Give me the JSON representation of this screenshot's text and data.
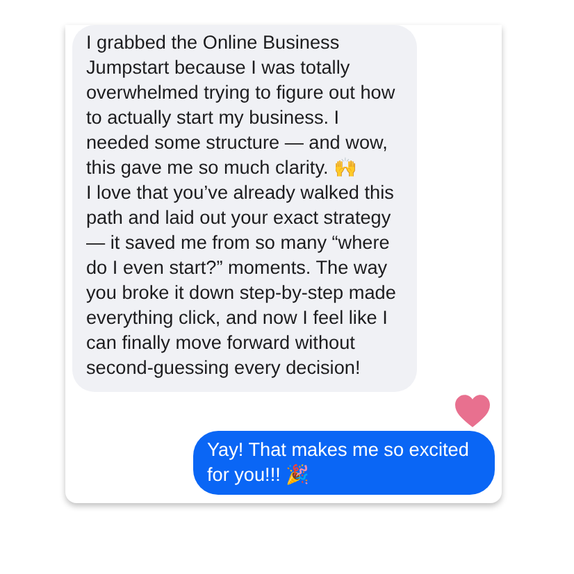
{
  "messages": [
    {
      "kind": "received",
      "paragraphs": [
        "I grabbed the Online Business Jumpstart because I was totally overwhelmed trying to figure out how to actually start my business. I needed some structure — and wow, this gave me so much clarity. 🙌",
        "I love that you’ve already walked this path and laid out your exact strategy — it saved me from so many “where do I even start?” moments. The way you broke it down step-by-step made everything click, and now I feel like I can finally move forward without second-guessing every decision!"
      ],
      "hearted": true
    },
    {
      "kind": "sent",
      "paragraphs": [
        "Yay! That makes me so excited for you!!! 🎉"
      ]
    }
  ]
}
